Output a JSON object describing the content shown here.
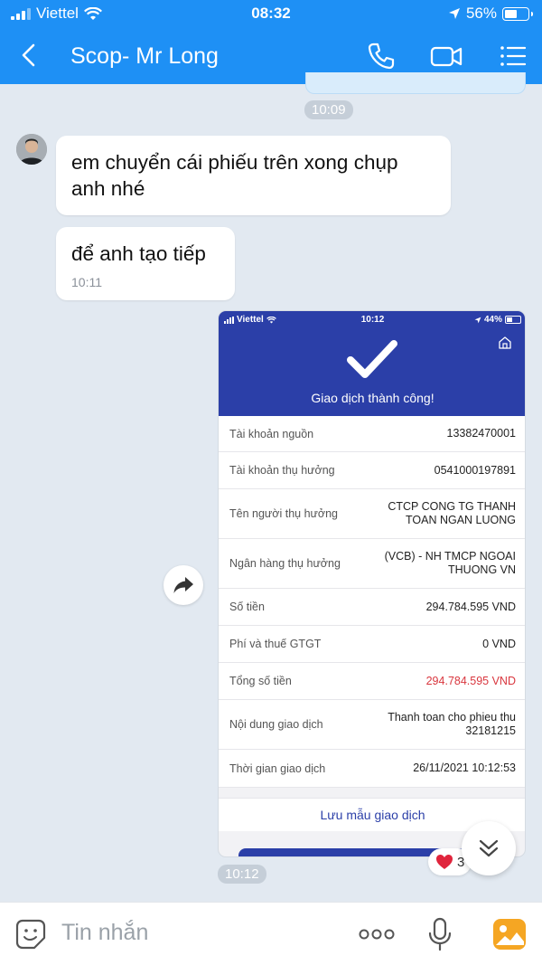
{
  "status_bar": {
    "carrier": "Viettel",
    "time": "08:32",
    "battery": "56%"
  },
  "header": {
    "title": "Scop- Mr Long"
  },
  "messages": {
    "prev_time": "10:09",
    "msg1": "em chuyển cái phiếu trên xong chụp anh nhé",
    "msg2": "để anh tạo tiếp",
    "msg2_time": "10:11",
    "image_time": "10:12"
  },
  "receipt": {
    "status": {
      "carrier": "Viettel",
      "time": "10:12",
      "battery": "44%"
    },
    "title": "Giao dịch thành công!",
    "rows": [
      {
        "label": "Tài khoản nguồn",
        "value": "13382470001"
      },
      {
        "label": "Tài khoản thụ hưởng",
        "value": "0541000197891"
      },
      {
        "label": "Tên người thụ hưởng",
        "value": "CTCP CONG TG THANH TOAN NGAN LUONG"
      },
      {
        "label": "Ngân hàng thụ hưởng",
        "value": "(VCB) - NH TMCP NGOAI THUONG VN"
      },
      {
        "label": "Số tiền",
        "value": "294.784.595 VND"
      },
      {
        "label": "Phí và thuế GTGT",
        "value": "0 VND"
      },
      {
        "label": "Tổng số tiền",
        "value": "294.784.595 VND"
      },
      {
        "label": "Nội dung giao dịch",
        "value": "Thanh toan cho phieu thu 32181215"
      },
      {
        "label": "Thời gian giao dịch",
        "value": "26/11/2021 10:12:53"
      }
    ],
    "save_label": "Lưu mẫu giao dịch"
  },
  "reaction": {
    "count": "3"
  },
  "input": {
    "placeholder": "Tin nhắn"
  },
  "colors": {
    "header": "#1e90f5",
    "receipt_blue": "#2b3fa8",
    "amount_red": "#d9363e"
  }
}
